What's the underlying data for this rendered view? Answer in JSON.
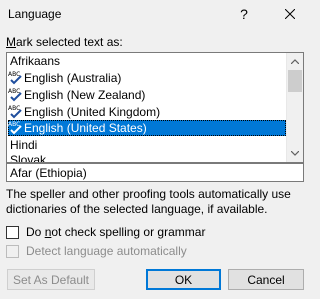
{
  "window": {
    "title": "Language",
    "help_label": "?"
  },
  "mark_label": {
    "prefix": "M",
    "rest": "ark selected text as:"
  },
  "languages": {
    "items": [
      {
        "label": "Afrikaans",
        "spell": false,
        "selected": false
      },
      {
        "label": "English (Australia)",
        "spell": true,
        "selected": false
      },
      {
        "label": "English (New Zealand)",
        "spell": true,
        "selected": false
      },
      {
        "label": "English (United Kingdom)",
        "spell": true,
        "selected": false
      },
      {
        "label": "English (United States)",
        "spell": true,
        "selected": true
      },
      {
        "label": "Hindi",
        "spell": false,
        "selected": false
      },
      {
        "label": "Slovak",
        "spell": false,
        "selected": false
      }
    ]
  },
  "combo": {
    "value": "Afar (Ethiopia)"
  },
  "description": "The speller and other proofing tools automatically use dictionaries of the selected language, if available.",
  "options": {
    "no_check": {
      "prefix": "Do ",
      "accel": "n",
      "rest": "ot check spelling or grammar",
      "checked": false,
      "enabled": true
    },
    "detect": {
      "label": "Detect language automatically",
      "checked": false,
      "enabled": false
    }
  },
  "buttons": {
    "set_default": "Set As Default",
    "ok": "OK",
    "cancel": "Cancel"
  },
  "colors": {
    "selection": "#0078d7",
    "background": "#f0f0f0",
    "disabled_text": "#8c8c8c"
  }
}
